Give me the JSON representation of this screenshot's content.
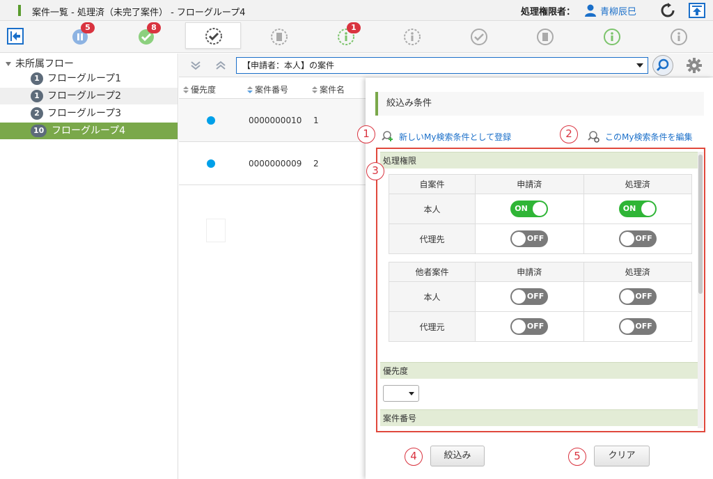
{
  "window": {
    "title": "案件一覧 - 処理済（未完了案件） - フローグループ4",
    "auth_label": "処理権限者：",
    "user_name": "青柳辰巳"
  },
  "toolbar": {
    "badges": {
      "in_progress": "5",
      "approved": "8",
      "info": "1"
    }
  },
  "tree": {
    "root_label": "未所属フロー",
    "items": [
      {
        "count": "1",
        "label": "フローグループ1"
      },
      {
        "count": "1",
        "label": "フローグループ2"
      },
      {
        "count": "2",
        "label": "フローグループ3"
      },
      {
        "count": "10",
        "label": "フローグループ4"
      }
    ]
  },
  "filterbar": {
    "selected_condition": "【申請者：本人】の案件"
  },
  "grid": {
    "columns": [
      "優先度",
      "案件番号",
      "案件名"
    ],
    "rows": [
      {
        "number": "0000000010",
        "name": "1"
      },
      {
        "number": "0000000009",
        "name": "2"
      }
    ]
  },
  "panel": {
    "title": "絞込み条件",
    "link_register": "新しいMy検索条件として登録",
    "link_edit": "このMy検索条件を編集",
    "callouts": [
      "1",
      "2",
      "3",
      "4",
      "5"
    ],
    "section_permission": "処理権限",
    "own_table": {
      "header": [
        "自案件",
        "申請済",
        "処理済"
      ],
      "rows": [
        {
          "label": "本人",
          "applied": "ON",
          "processed": "ON"
        },
        {
          "label": "代理先",
          "applied": "OFF",
          "processed": "OFF"
        }
      ]
    },
    "other_table": {
      "header": [
        "他者案件",
        "申請済",
        "処理済"
      ],
      "rows": [
        {
          "label": "本人",
          "applied": "OFF",
          "processed": "OFF"
        },
        {
          "label": "代理元",
          "applied": "OFF",
          "processed": "OFF"
        }
      ]
    },
    "section_priority": "優先度",
    "section_number": "案件番号",
    "btn_filter": "絞込み",
    "btn_clear": "クリア"
  }
}
